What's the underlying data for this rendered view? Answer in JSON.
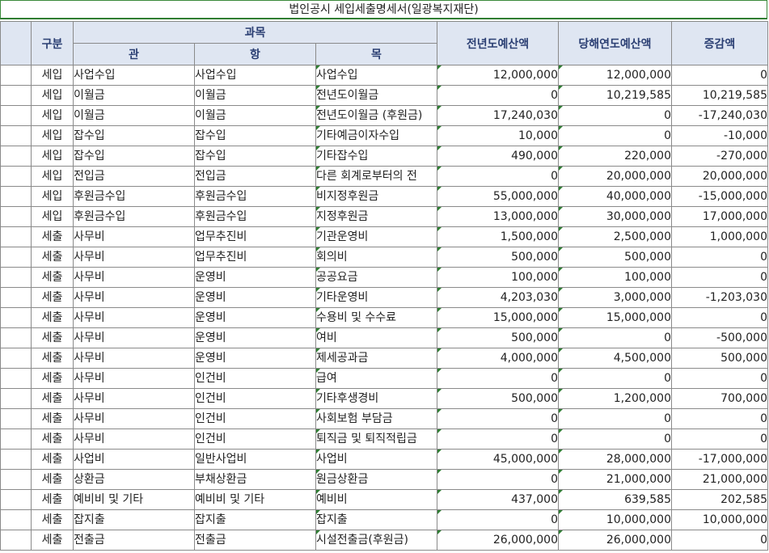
{
  "title": "법인공시 세입세출명세서(일광복지재단)",
  "headers": {
    "gubun": "구분",
    "gwamok": "과목",
    "gwan": "관",
    "hang": "항",
    "mok": "목",
    "prev_budget": "전년도예산액",
    "curr_budget": "당해연도예산액",
    "diff": "증감액"
  },
  "rows": [
    {
      "gubun": "세입",
      "gwan": "사업수입",
      "hang": "사업수입",
      "mok": "사업수입",
      "prev": "12,000,000",
      "curr": "12,000,000",
      "diff": "0"
    },
    {
      "gubun": "세입",
      "gwan": "이월금",
      "hang": "이월금",
      "mok": "전년도이월금",
      "prev": "0",
      "curr": "10,219,585",
      "diff": "10,219,585"
    },
    {
      "gubun": "세입",
      "gwan": "이월금",
      "hang": "이월금",
      "mok": "전년도이월금 (후원금)",
      "prev": "17,240,030",
      "curr": "0",
      "diff": "-17,240,030"
    },
    {
      "gubun": "세입",
      "gwan": "잡수입",
      "hang": "잡수입",
      "mok": "기타예금이자수입",
      "prev": "10,000",
      "curr": "0",
      "diff": "-10,000"
    },
    {
      "gubun": "세입",
      "gwan": "잡수입",
      "hang": "잡수입",
      "mok": "기타잡수입",
      "prev": "490,000",
      "curr": "220,000",
      "diff": "-270,000"
    },
    {
      "gubun": "세입",
      "gwan": "전입금",
      "hang": "전입금",
      "mok": "다른 회계로부터의 전",
      "prev": "0",
      "curr": "20,000,000",
      "diff": "20,000,000"
    },
    {
      "gubun": "세입",
      "gwan": "후원금수입",
      "hang": "후원금수입",
      "mok": "비지정후원금",
      "prev": "55,000,000",
      "curr": "40,000,000",
      "diff": "-15,000,000"
    },
    {
      "gubun": "세입",
      "gwan": "후원금수입",
      "hang": "후원금수입",
      "mok": "지정후원금",
      "prev": "13,000,000",
      "curr": "30,000,000",
      "diff": "17,000,000"
    },
    {
      "gubun": "세출",
      "gwan": "사무비",
      "hang": "업무추진비",
      "mok": "기관운영비",
      "prev": "1,500,000",
      "curr": "2,500,000",
      "diff": "1,000,000"
    },
    {
      "gubun": "세출",
      "gwan": "사무비",
      "hang": "업무추진비",
      "mok": "회의비",
      "prev": "500,000",
      "curr": "500,000",
      "diff": "0"
    },
    {
      "gubun": "세출",
      "gwan": "사무비",
      "hang": "운영비",
      "mok": "공공요금",
      "prev": "100,000",
      "curr": "100,000",
      "diff": "0"
    },
    {
      "gubun": "세출",
      "gwan": "사무비",
      "hang": "운영비",
      "mok": "기타운영비",
      "prev": "4,203,030",
      "curr": "3,000,000",
      "diff": "-1,203,030"
    },
    {
      "gubun": "세출",
      "gwan": "사무비",
      "hang": "운영비",
      "mok": "수용비 및 수수료",
      "prev": "15,000,000",
      "curr": "15,000,000",
      "diff": "0"
    },
    {
      "gubun": "세출",
      "gwan": "사무비",
      "hang": "운영비",
      "mok": "여비",
      "prev": "500,000",
      "curr": "0",
      "diff": "-500,000"
    },
    {
      "gubun": "세출",
      "gwan": "사무비",
      "hang": "운영비",
      "mok": "제세공과금",
      "prev": "4,000,000",
      "curr": "4,500,000",
      "diff": "500,000"
    },
    {
      "gubun": "세출",
      "gwan": "사무비",
      "hang": "인건비",
      "mok": "급여",
      "prev": "0",
      "curr": "0",
      "diff": "0"
    },
    {
      "gubun": "세출",
      "gwan": "사무비",
      "hang": "인건비",
      "mok": "기타후생경비",
      "prev": "500,000",
      "curr": "1,200,000",
      "diff": "700,000"
    },
    {
      "gubun": "세출",
      "gwan": "사무비",
      "hang": "인건비",
      "mok": "사회보험 부담금",
      "prev": "0",
      "curr": "0",
      "diff": "0"
    },
    {
      "gubun": "세출",
      "gwan": "사무비",
      "hang": "인건비",
      "mok": "퇴직금 및 퇴직적립금",
      "prev": "0",
      "curr": "0",
      "diff": "0"
    },
    {
      "gubun": "세출",
      "gwan": "사업비",
      "hang": "일반사업비",
      "mok": "사업비",
      "prev": "45,000,000",
      "curr": "28,000,000",
      "diff": "-17,000,000"
    },
    {
      "gubun": "세출",
      "gwan": "상환금",
      "hang": "부채상환금",
      "mok": "원금상환금",
      "prev": "0",
      "curr": "21,000,000",
      "diff": "21,000,000"
    },
    {
      "gubun": "세출",
      "gwan": "예비비 및 기타",
      "hang": "예비비 및 기타",
      "mok": "예비비",
      "prev": "437,000",
      "curr": "639,585",
      "diff": "202,585"
    },
    {
      "gubun": "세출",
      "gwan": "잡지출",
      "hang": "잡지출",
      "mok": "잡지출",
      "prev": "0",
      "curr": "10,000,000",
      "diff": "10,000,000"
    },
    {
      "gubun": "세출",
      "gwan": "전출금",
      "hang": "전출금",
      "mok": "시설전출금(후원금)",
      "prev": "26,000,000",
      "curr": "26,000,000",
      "diff": "0"
    }
  ]
}
